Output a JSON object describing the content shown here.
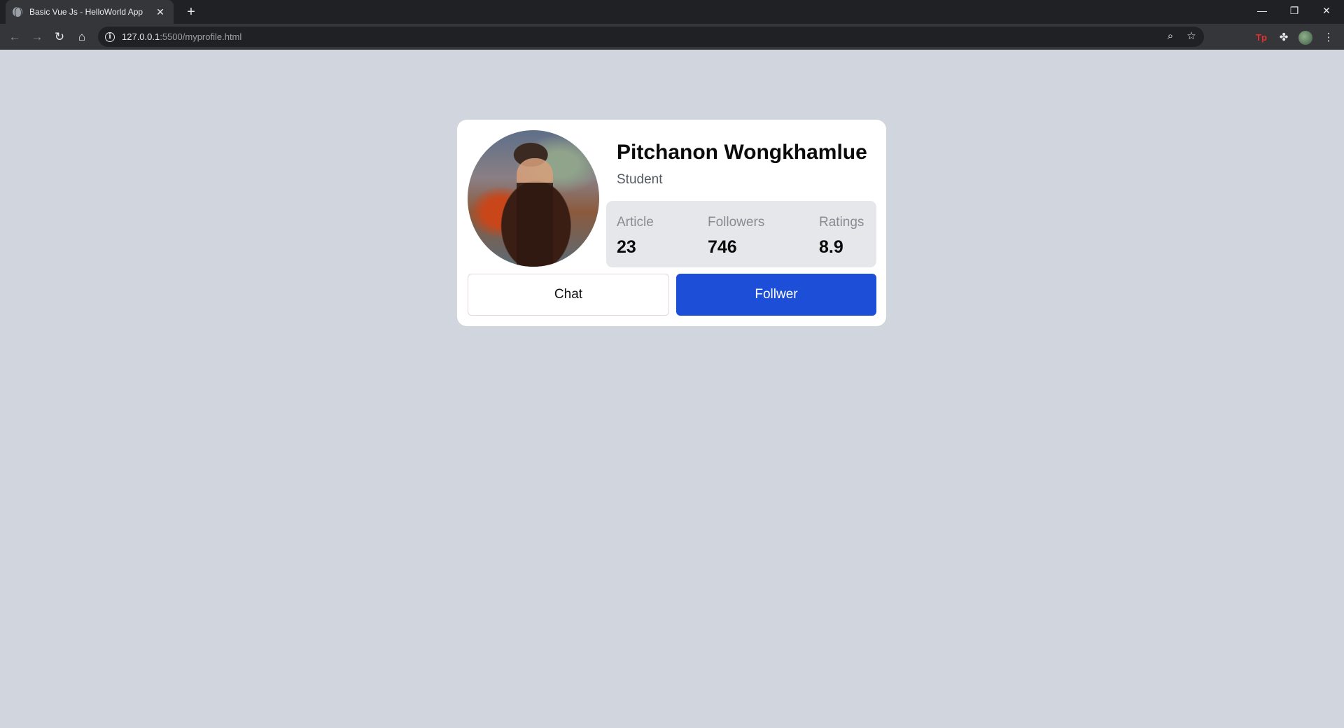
{
  "browser": {
    "tab_title": "Basic Vue Js - HelloWorld App",
    "tab_close": "✕",
    "new_tab": "+",
    "url_host": "127.0.0.1",
    "url_path": ":5500/myprofile.html",
    "controls": {
      "minimize": "—",
      "restore": "❐",
      "close": "✕"
    },
    "nav": {
      "back": "←",
      "forward": "→",
      "reload": "↻",
      "home": "⌂"
    },
    "extensions": {
      "tp": "Tp"
    }
  },
  "profile": {
    "name": "Pitchanon Wongkhamlue",
    "role": "Student",
    "stats": [
      {
        "label": "Article",
        "value": "23"
      },
      {
        "label": "Followers",
        "value": "746"
      },
      {
        "label": "Ratings",
        "value": "8.9"
      }
    ],
    "chat_label": "Chat",
    "follow_label": "Follwer"
  },
  "colors": {
    "page_bg": "#d1d5de",
    "card_bg": "#ffffff",
    "stats_bg": "#e5e7eb",
    "follow_button": "#1d4ed8"
  }
}
